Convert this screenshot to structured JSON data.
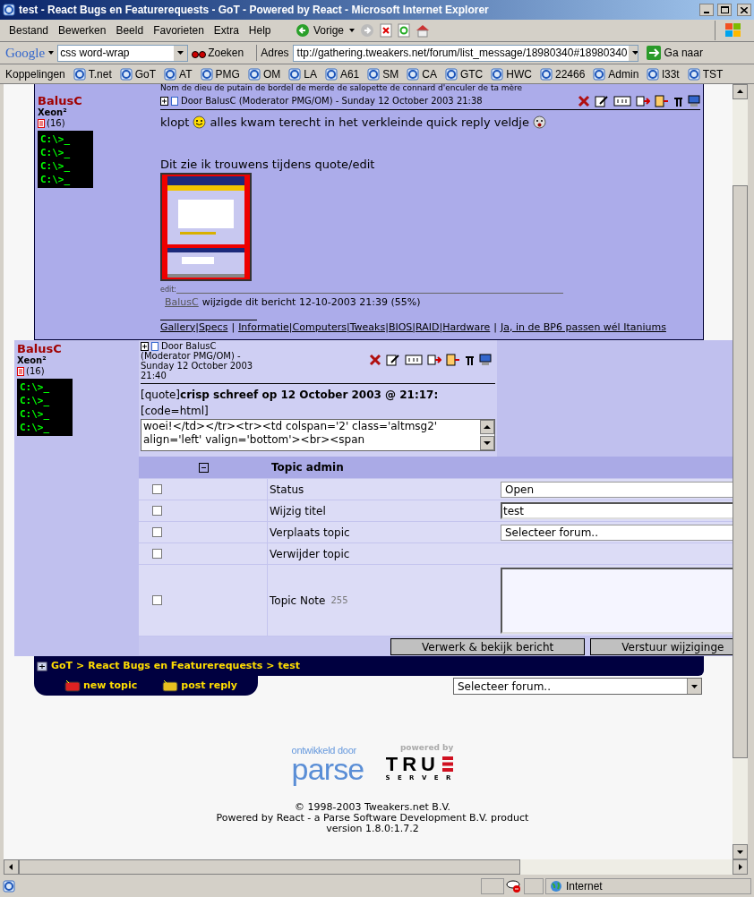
{
  "window": {
    "title": "test - React Bugs en Featurerequests - GoT - Powered by React - Microsoft Internet Explorer"
  },
  "menu": [
    "Bestand",
    "Bewerken",
    "Beeld",
    "Favorieten",
    "Extra",
    "Help"
  ],
  "toolbar": {
    "back": "Vorige"
  },
  "google": {
    "logo": "Google",
    "query": "css word-wrap",
    "search": "Zoeken"
  },
  "address": {
    "label": "Adres",
    "url": "ttp://gathering.tweakers.net/forum/list_message/18980340#18980340",
    "go": "Ga naar"
  },
  "links": {
    "label": "Koppelingen",
    "items": [
      "T.net",
      "GoT",
      "AT",
      "PMG",
      "OM",
      "LA",
      "A61",
      "SM",
      "CA",
      "GTC",
      "HWC",
      "22466",
      "Admin",
      "l33t",
      "TST"
    ]
  },
  "clipped_line": "Nom de dieu de putain de bordel de merde de salopette de connard d'enculer de ta mère",
  "post1": {
    "author": "BalusC",
    "rank": "Xeon²",
    "count": "(16)",
    "avatar_lines": [
      "C:\\>_",
      "C:\\>_",
      "C:\\>_",
      "C:\\>_"
    ],
    "header": "Door BalusC (Moderator PMG/OM) - Sunday 12 October 2003 21:38",
    "line1_start": "klopt",
    "line1_end": "alles kwam terecht in het verkleinde quick reply veldje",
    "line2": "Dit zie ik trouwens tijdens quote/edit",
    "edit_label": "edit:",
    "edit_user": "BalusC",
    "edit_text": "wijzigde dit bericht 12-10-2003 21:39 (55%)",
    "signature": [
      "Gallery|Specs",
      "Informatie|Computers|Tweaks|BIOS|RAID|Hardware",
      "Ja, in de BP6 passen wél Itaniums"
    ],
    "separator": "|"
  },
  "post2": {
    "author": "BalusC",
    "rank": "Xeon²",
    "count": "(16)",
    "avatar_lines": [
      "C:\\>_",
      "C:\\>_",
      "C:\\>_",
      "C:\\>_"
    ],
    "header_lines": [
      "Door BalusC",
      "(Moderator PMG/OM) -",
      "Sunday 12 October 2003",
      "21:40"
    ],
    "quote_tag": "[quote]",
    "quote_bold": "crisp schreef op 12 October 2003 @ 21:17:",
    "code_tag": "[code=html]",
    "textarea": "woei!</td></tr><tr><td colspan='2' class='altmsg2' align='left' valign='bottom'><br><span"
  },
  "admin": {
    "title": "Topic admin",
    "rows": [
      {
        "kind": "select",
        "label": "Status",
        "value": "Open",
        "checked": false
      },
      {
        "kind": "text",
        "label": "Wijzig titel",
        "value": "test",
        "checked": false
      },
      {
        "kind": "select",
        "label": "Verplaats topic",
        "value": "Selecteer forum..",
        "checked": false
      },
      {
        "kind": "none",
        "label": "Verwijder topic",
        "checked": false
      },
      {
        "kind": "textarea",
        "label": "Topic Note",
        "hint": "255",
        "checked": false
      }
    ],
    "buttons": [
      "Verwerk & bekijk bericht",
      "Verstuur wijziginge"
    ]
  },
  "breadcrumb": [
    "GoT",
    "React Bugs en Featurerequests",
    "test"
  ],
  "breadcrumb_separator": ">",
  "actions": [
    "new topic",
    "post reply"
  ],
  "forum_select": "Selecteer forum..",
  "footer": {
    "parse_small": "ontwikkeld door",
    "parse": "parse",
    "true_small": "powered by",
    "true": "TRU",
    "server": "S E R V E R",
    "lines": [
      "© 1998-2003 Tweakers.net B.V.",
      "Powered by React - a Parse Software Development B.V. product",
      "version 1.8.0:1.7.2"
    ]
  },
  "status": {
    "zone": "Internet"
  }
}
